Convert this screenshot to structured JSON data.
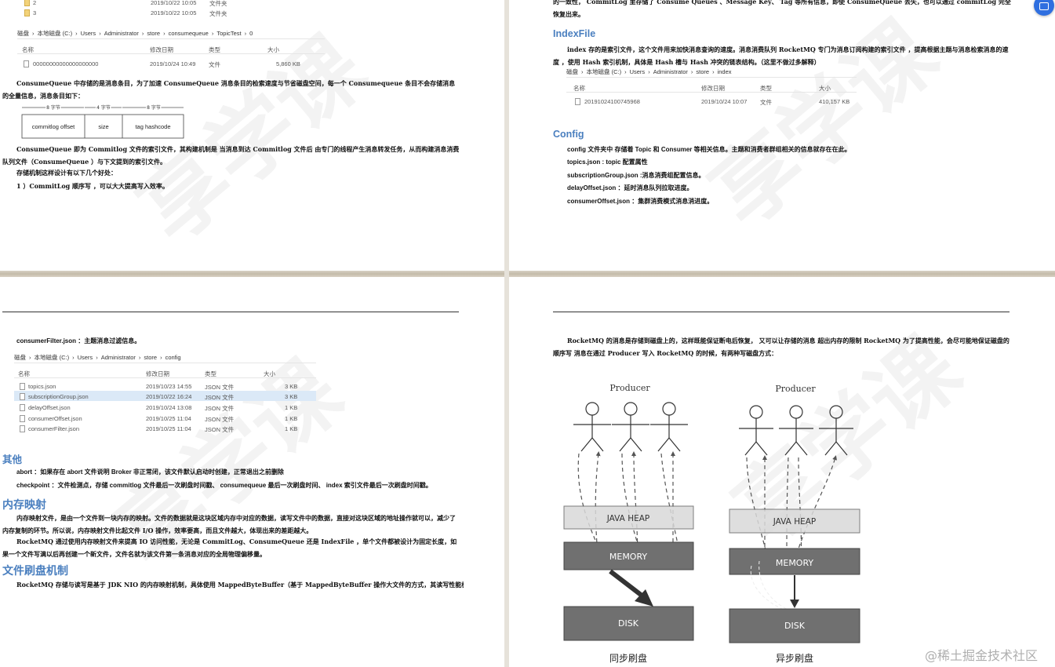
{
  "corner_watermark": "@稀土掘金技术社区",
  "page_tl": {
    "top_rows": [
      {
        "name": "2",
        "date": "2019/10/22 10:05",
        "type": "文件夹"
      },
      {
        "name": "3",
        "date": "2019/10/22 10:05",
        "type": "文件夹"
      }
    ],
    "explorer": {
      "crumbs": [
        "磁盘",
        "›",
        "本地磁盘 (C:)",
        "›",
        "Users",
        "›",
        "Administrator",
        "›",
        "store",
        "›",
        "consumequeue",
        "›",
        "TopicTest",
        "›",
        "0"
      ],
      "headers": {
        "name": "名称",
        "date": "修改日期",
        "type": "类型",
        "size": "大小"
      },
      "rows": [
        {
          "name": "00000000000000000000",
          "date": "2019/10/24 10:49",
          "type": "文件",
          "size": "5,860 KB"
        }
      ]
    },
    "para1": "ConsumeQueue 中存储的是消息条目，为了加速 ConsumeQueue 消息条目的检索速度与节省磁盘空间，每一个 Consumequeue 条目不会存储消息的全量信息，消息条目如下：",
    "entry_diagram": {
      "bytes": [
        "8 字节",
        "4 字节",
        "8 字节"
      ],
      "cells": [
        "commitlog offset",
        "size",
        "tag hashcode"
      ]
    },
    "para2": "ConsumeQueue 即为 Commitlog 文件的索引文件，其构建机制是 当消息到达 Commitlog 文件后 由专门的线程产生消息转发任务，从而构建消息消费队列文件（ConsumeQueue ）与下文提到的索引文件。",
    "para3": "存储机制这样设计有以下几个好处：",
    "para4": "1 ）CommitLog 顺序写 ，可以大大提高写入效率。"
  },
  "page_tr": {
    "top_text": "的一致性， CommitLog 里存储了 Consume Queues 、Message Key、 Tag 等所有信息，即使 ConsumeQueue 丢失，也可以通过 commitLog 完全恢复出来。",
    "indexfile_title": "IndexFile",
    "indexfile_text": "index 存的是索引文件，这个文件用来加快消息查询的速度。消息消费队列 RocketMQ 专门为消息订阅构建的索引文件 ，提高根据主题与消息检索消息的速度 ，使用 Hash 索引机制，具体是 Hash 槽与 Hash 冲突的链表结构。（这里不做过多解释）",
    "explorer": {
      "crumbs": [
        "磁盘",
        "›",
        "本地磁盘 (C:)",
        "›",
        "Users",
        "›",
        "Administrator",
        "›",
        "store",
        "›",
        "index"
      ],
      "headers": {
        "name": "名称",
        "date": "修改日期",
        "type": "类型",
        "size": "大小"
      },
      "rows": [
        {
          "name": "20191024100745968",
          "date": "2019/10/24 10:07",
          "type": "文件",
          "size": "410,157 KB"
        }
      ]
    },
    "config_title": "Config",
    "config_lines": [
      "config 文件夹中 存储着 Topic 和 Consumer 等相关信息。主题和消费者群组相关的信息就存在在此。",
      "topics.json : topic 配置属性",
      "subscriptionGroup.json :消息消费组配置信息。",
      "delayOffset.json ：延时消息队列拉取进度。",
      "consumerOffset.json ：集群消费模式消息消进度。"
    ]
  },
  "page_bl": {
    "line0": "consumerFilter.json ：主题消息过滤信息。",
    "explorer": {
      "crumbs": [
        "磁盘",
        "›",
        "本地磁盘 (C:)",
        "›",
        "Users",
        "›",
        "Administrator",
        "›",
        "store",
        "›",
        "config"
      ],
      "headers": {
        "name": "名称",
        "date": "修改日期",
        "type": "类型",
        "size": "大小"
      },
      "rows": [
        {
          "name": "topics.json",
          "date": "2019/10/23 14:55",
          "type": "JSON 文件",
          "size": "3 KB"
        },
        {
          "name": "subscriptionGroup.json",
          "date": "2019/10/22 16:24",
          "type": "JSON 文件",
          "size": "3 KB"
        },
        {
          "name": "delayOffset.json",
          "date": "2019/10/24 13:08",
          "type": "JSON 文件",
          "size": "1 KB"
        },
        {
          "name": "consumerOffset.json",
          "date": "2019/10/25 11:04",
          "type": "JSON 文件",
          "size": "1 KB"
        },
        {
          "name": "consumerFilter.json",
          "date": "2019/10/25 11:04",
          "type": "JSON 文件",
          "size": "1 KB"
        }
      ]
    },
    "other_title": "其他",
    "other_lines": [
      "abort ：如果存在 abort 文件说明 Broker 非正常闭，该文件默认启动时创建，正常退出之前删除",
      "checkpoint ：文件检测点，存储 commitlog 文件最后一次刷盘时间戳、 consumequeue 最后一次刷盘时间、 index 索引文件最后一次刷盘时间戳。"
    ],
    "mmap_title": "内存映射",
    "mmap_p1": "内存映射文件，是由一个文件到一块内存的映射。文件的数据就是这块区域内存中对应的数据，读写文件中的数据，直接对这块区域的地址操作就可以，减少了内存复制的环节。所以说，内存映射文件比起文件 I/O 操作，效率要高，而且文件越大，体现出来的差距越大。",
    "mmap_p2": "RocketMQ 通过使用内存映射文件来提高 IO 访问性能，无论是 CommitLog、ConsumeQueue 还是 IndexFile ，单个文件都被设计为固定长度，如果一个文件写满以后再创建一个新文件，文件名就为该文件第一条消息对应的全局物理偏移量。",
    "flush_title": "文件刷盘机制",
    "flush_p": "RocketMQ 存储与读写是基于 JDK NIO 的内存映射机制，具体使用 MappedByteBuffer（基于 MappedByteBuffer 操作大文件的方式，其读写性能极高）"
  },
  "page_br": {
    "para": "RocketMQ 的消息是存储到磁盘上的，这样既能保证断电后恢复， 又可以让存储的消息 超出内存的限制 RocketMQ 为了提高性能，会尽可能地保证磁盘的顺序写 消息在通过 Producer 写入 RocketMQ 的时候，有两种写磁盘方式：",
    "left": {
      "producer": "Producer",
      "heap": "JAVA   HEAP",
      "memory": "MEMORY",
      "disk": "DISK",
      "caption": "同步刷盘"
    },
    "right": {
      "producer": "Producer",
      "heap": "JAVA HEAP",
      "memory": "MEMORY",
      "disk": "DISK",
      "caption": "异步刷盘"
    }
  }
}
